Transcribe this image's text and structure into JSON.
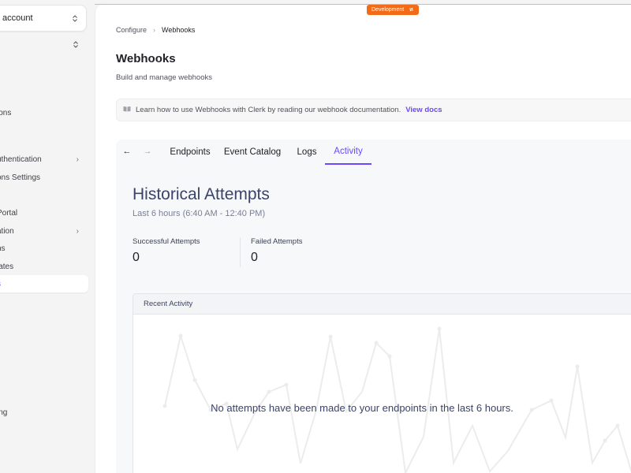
{
  "sidebar": {
    "org_switcher_label": "account",
    "items": [
      {
        "id": "options",
        "label": "ions"
      },
      {
        "id": "authentication",
        "label": "uthentication",
        "chevron": "›"
      },
      {
        "id": "sessions-settings",
        "label": "ons Settings"
      },
      {
        "id": "portal",
        "label": "Portal"
      },
      {
        "id": "ation",
        "label": "ation",
        "chevron": "›"
      },
      {
        "id": "ons",
        "label": "ns"
      },
      {
        "id": "templates",
        "label": "lates"
      },
      {
        "id": "webhooks",
        "label": "s",
        "active": true
      },
      {
        "id": "ing",
        "label": "ing"
      }
    ]
  },
  "environment_badge": {
    "label": "Development",
    "icon": "swap-icon"
  },
  "breadcrumb": {
    "parent": "Configure",
    "separator": "›",
    "current": "Webhooks"
  },
  "header": {
    "title": "Webhooks",
    "subtitle": "Build and manage webhooks"
  },
  "info_banner": {
    "icon": "book-icon",
    "text": "Learn how to use Webhooks with Clerk by reading our webhook documentation.",
    "link": "View docs"
  },
  "portal": {
    "back": "←",
    "forward": "→",
    "tabs": [
      {
        "label": "Endpoints",
        "active": false
      },
      {
        "label": "Event Catalog",
        "active": false
      },
      {
        "label": "Logs",
        "active": false
      },
      {
        "label": "Activity",
        "active": true
      }
    ],
    "historical": {
      "title": "Historical Attempts",
      "range": "Last 6 hours (6:40 AM - 12:40 PM)"
    },
    "stats": [
      {
        "label": "Successful Attempts",
        "value": "0"
      },
      {
        "label": "Failed Attempts",
        "value": "0"
      }
    ],
    "recent_activity": {
      "title": "Recent Activity",
      "empty_message": "No attempts have been made to your endpoints in the last 6 hours."
    }
  },
  "colors": {
    "accent": "#6c47ff",
    "dev_badge": "#f36b16",
    "placeholder_line": "#ececee"
  }
}
